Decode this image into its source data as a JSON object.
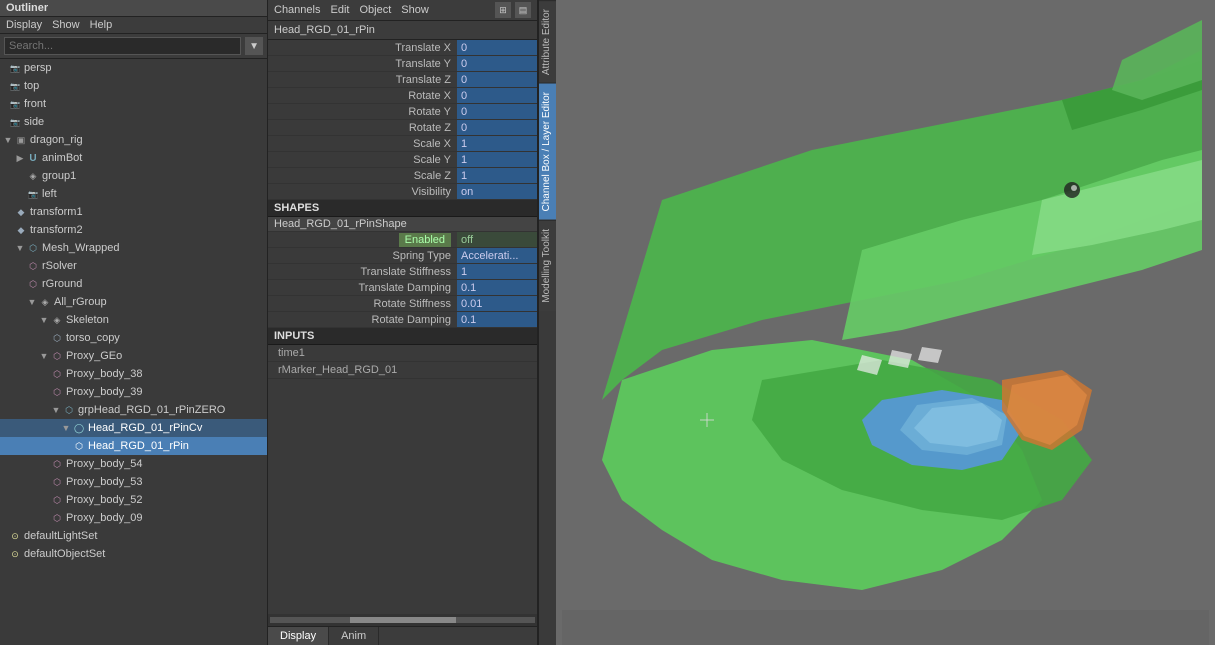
{
  "menu": {
    "title": "Outliner",
    "items": [
      "Display",
      "Show",
      "Help"
    ]
  },
  "outliner": {
    "search_placeholder": "Search...",
    "menu_items": [
      "Display",
      "Show",
      "Help"
    ],
    "tree": [
      {
        "id": "persp",
        "label": "persp",
        "indent": 1,
        "type": "cam"
      },
      {
        "id": "top",
        "label": "top",
        "indent": 1,
        "type": "cam"
      },
      {
        "id": "front",
        "label": "front",
        "indent": 1,
        "type": "cam"
      },
      {
        "id": "side",
        "label": "side",
        "indent": 1,
        "type": "cam"
      },
      {
        "id": "dragon_rig",
        "label": "dragon_rig",
        "indent": 0,
        "type": "group",
        "expand": true
      },
      {
        "id": "animBot",
        "label": "animBot",
        "indent": 1,
        "type": "anim",
        "expand": false
      },
      {
        "id": "group1",
        "label": "group1",
        "indent": 2,
        "type": "group"
      },
      {
        "id": "left",
        "label": "left",
        "indent": 2,
        "type": "cam"
      },
      {
        "id": "transform1",
        "label": "transform1",
        "indent": 1,
        "type": "transform"
      },
      {
        "id": "transform2",
        "label": "transform2",
        "indent": 1,
        "type": "transform"
      },
      {
        "id": "Mesh_Wrapped",
        "label": "Mesh_Wrapped",
        "indent": 1,
        "type": "mesh",
        "expand": true
      },
      {
        "id": "rSolver",
        "label": "rSolver",
        "indent": 2,
        "type": "proxy"
      },
      {
        "id": "rGround",
        "label": "rGround",
        "indent": 2,
        "type": "proxy"
      },
      {
        "id": "All_rGroup",
        "label": "All_rGroup",
        "indent": 2,
        "type": "group",
        "expand": true
      },
      {
        "id": "Skeleton",
        "label": "Skeleton",
        "indent": 3,
        "type": "group",
        "expand": true
      },
      {
        "id": "torso_copy",
        "label": "torso_copy",
        "indent": 4,
        "type": "mesh"
      },
      {
        "id": "Proxy_GEo",
        "label": "Proxy_GEo",
        "indent": 3,
        "type": "mesh",
        "expand": true
      },
      {
        "id": "Proxy_body_38",
        "label": "Proxy_body_38",
        "indent": 4,
        "type": "proxy"
      },
      {
        "id": "Proxy_body_39",
        "label": "Proxy_body_39",
        "indent": 4,
        "type": "proxy"
      },
      {
        "id": "grpHead_RGD_01_rPinZERO",
        "label": "grpHead_RGD_01_rPinZERO",
        "indent": 4,
        "type": "group",
        "expand": true
      },
      {
        "id": "Head_RGD_01_rPinCv",
        "label": "Head_RGD_01_rPinCv",
        "indent": 5,
        "type": "curve",
        "selected_light": true
      },
      {
        "id": "Head_RGD_01_rPin",
        "label": "Head_RGD_01_rPin",
        "indent": 6,
        "type": "pin",
        "selected": true
      },
      {
        "id": "Proxy_body_54",
        "label": "Proxy_body_54",
        "indent": 4,
        "type": "proxy"
      },
      {
        "id": "Proxy_body_53",
        "label": "Proxy_body_53",
        "indent": 4,
        "type": "proxy"
      },
      {
        "id": "Proxy_body_52",
        "label": "Proxy_body_52",
        "indent": 4,
        "type": "proxy"
      },
      {
        "id": "Proxy_body_09",
        "label": "Proxy_body_09",
        "indent": 4,
        "type": "proxy"
      },
      {
        "id": "defaultLightSet",
        "label": "defaultLightSet",
        "indent": 0,
        "type": "lightset"
      },
      {
        "id": "defaultObjectSet",
        "label": "defaultObjectSet",
        "indent": 0,
        "type": "objectset"
      }
    ]
  },
  "channel_box": {
    "menu_items": [
      "Channels",
      "Edit",
      "Object",
      "Show"
    ],
    "object_name": "Head_RGD_01_rPin",
    "channels": [
      {
        "label": "Translate X",
        "value": "0",
        "style": "blue"
      },
      {
        "label": "Translate Y",
        "value": "0",
        "style": "blue"
      },
      {
        "label": "Translate Z",
        "value": "0",
        "style": "blue"
      },
      {
        "label": "Rotate X",
        "value": "0",
        "style": "blue"
      },
      {
        "label": "Rotate Y",
        "value": "0",
        "style": "blue"
      },
      {
        "label": "Rotate Z",
        "value": "0",
        "style": "blue"
      },
      {
        "label": "Scale X",
        "value": "1",
        "style": "blue"
      },
      {
        "label": "Scale Y",
        "value": "1",
        "style": "blue"
      },
      {
        "label": "Scale Z",
        "value": "1",
        "style": "blue"
      },
      {
        "label": "Visibility",
        "value": "on",
        "style": "blue"
      }
    ],
    "shapes_header": "SHAPES",
    "shape_name": "Head_RGD_01_rPinShape",
    "shape_channels": [
      {
        "label": "Enabled",
        "value": "off",
        "style": "enabled"
      },
      {
        "label": "Spring Type",
        "value": "Accelerati...",
        "style": "blue"
      },
      {
        "label": "Translate Stiffness",
        "value": "1",
        "style": "blue"
      },
      {
        "label": "Translate Damping",
        "value": "0.1",
        "style": "blue"
      },
      {
        "label": "Rotate Stiffness",
        "value": "0.01",
        "style": "blue"
      },
      {
        "label": "Rotate Damping",
        "value": "0.1",
        "style": "blue"
      }
    ],
    "inputs_header": "INPUTS",
    "inputs": [
      "time1",
      "rMarker_Head_RGD_01"
    ]
  },
  "side_tabs": [
    {
      "label": "Attribute Editor",
      "active": false
    },
    {
      "label": "Channel Box / Layer Editor",
      "active": true
    },
    {
      "label": "Modelling Toolkit",
      "active": false
    }
  ],
  "bottom_tabs": [
    {
      "label": "Display",
      "active": true
    },
    {
      "label": "Anim",
      "active": false
    }
  ],
  "viewport": {
    "background_color": "#6a6a6a"
  }
}
